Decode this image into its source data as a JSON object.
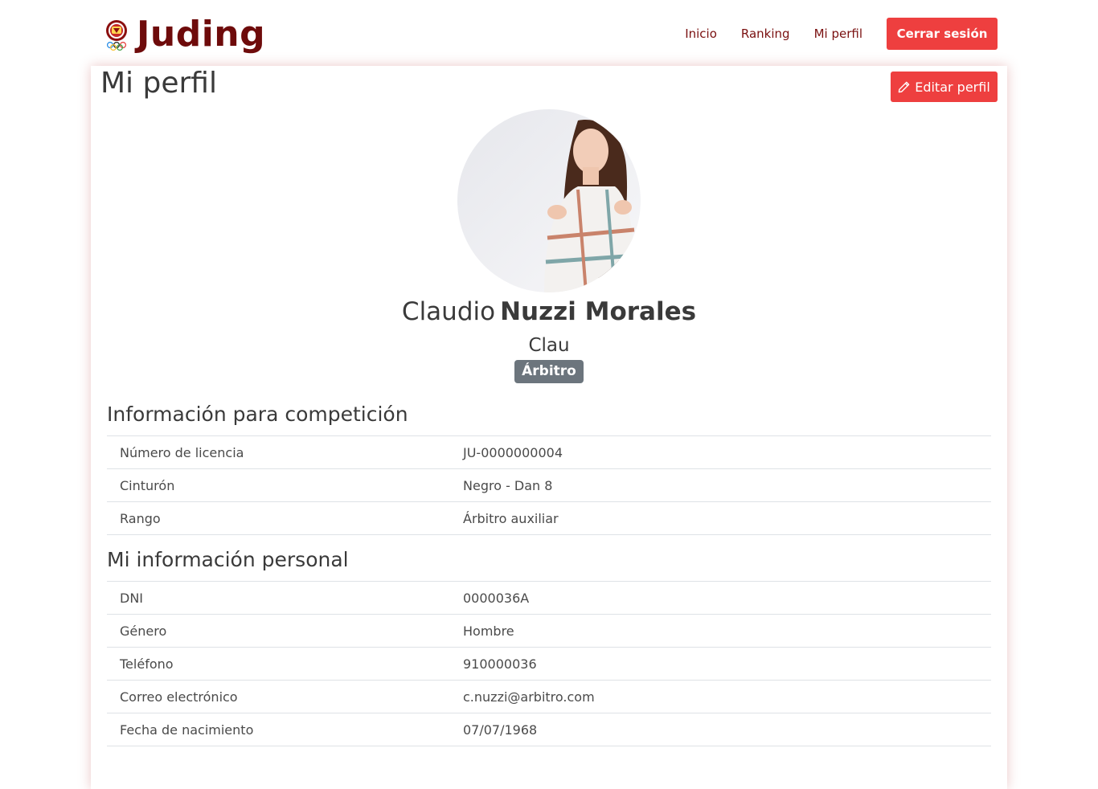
{
  "brand": {
    "name": "Juding",
    "logo_icon": "judo-federation-logo-icon"
  },
  "nav": {
    "items": [
      "Inicio",
      "Ranking",
      "Mi perfil"
    ],
    "logout_label": "Cerrar sesión"
  },
  "page": {
    "title": "Mi perfil",
    "edit_label": "Editar perfil",
    "edit_icon": "pencil-icon"
  },
  "profile": {
    "first_name": "Claudio",
    "last_name": "Nuzzi Morales",
    "nickname": "Clau",
    "role": "Árbitro"
  },
  "competition": {
    "title": "Información para competición",
    "rows": [
      {
        "label": "Número de licencia",
        "value": "JU-0000000004"
      },
      {
        "label": "Cinturón",
        "value": "Negro - Dan 8"
      },
      {
        "label": "Rango",
        "value": "Árbitro auxiliar"
      }
    ]
  },
  "personal": {
    "title": "Mi información personal",
    "rows": [
      {
        "label": "DNI",
        "value": "0000036A"
      },
      {
        "label": "Género",
        "value": "Hombre"
      },
      {
        "label": "Teléfono",
        "value": "910000036"
      },
      {
        "label": "Correo electrónico",
        "value": "c.nuzzi@arbitro.com"
      },
      {
        "label": "Fecha de nacimiento",
        "value": "07/07/1968"
      }
    ]
  },
  "colors": {
    "brand": "#6e0b0b",
    "accent": "#ee3f3f",
    "badge": "#6c757d"
  }
}
